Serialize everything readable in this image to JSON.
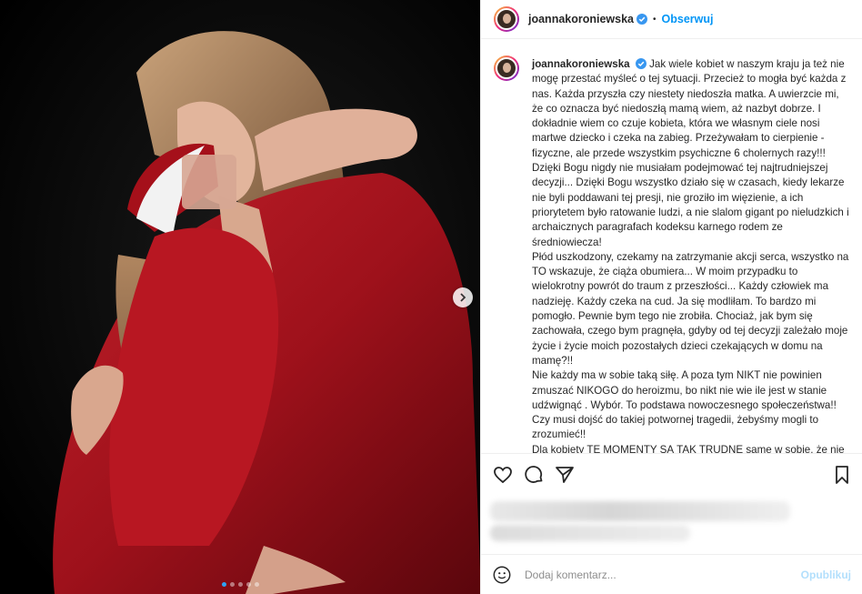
{
  "post": {
    "username": "joannakoroniewska",
    "separator": "•",
    "follow_label": "Obserwuj",
    "caption": [
      "Jak wiele kobiet w naszym kraju ja też nie mogę przestać myśleć o tej sytuacji. Przecież to mogła być każda z nas. Każda przyszła czy niestety niedoszła matka. A uwierzcie mi, że co oznacza być niedoszłą mamą wiem, aż nazbyt dobrze. I dokładnie wiem co czuje kobieta, która we własnym ciele nosi martwe dziecko i czeka na zabieg. Przeżywałam to cierpienie - fizyczne, ale przede wszystkim psychiczne 6 cholernych razy!!! Dzięki Bogu nigdy nie musiałam podejmować tej najtrudniejszej decyzji... Dzięki Bogu wszystko działo się w czasach, kiedy lekarze nie byli poddawani tej presji, nie groziło im więzienie, a ich priorytetem było ratowanie ludzi, a nie slalom gigant po nieludzkich i archaicznych paragrafach kodeksu karnego rodem ze średniowiecza!",
      "Płód uszkodzony, czekamy na zatrzymanie akcji serca, wszystko na TO wskazuje, że ciąża obumiera... W moim przypadku to wielokrotny powrót do traum z przeszłości... Każdy człowiek ma nadzieję. Każdy czeka na cud. Ja się modliłam. To bardzo mi pomogło. Pewnie bym tego nie zrobiła. Chociaż, jak bym się zachowała, czego bym pragnęła, gdyby od tej decyzji zależało moje życie i życie moich pozostałych dzieci czekających w domu na mamę?!!",
      "Nie każdy ma w sobie taką siłę. A poza tym NIKT nie powinien zmuszać NIKOGO do heroizmu, bo nikt nie wie ile jest w stanie udźwignąć . Wybór. To podstawa nowoczesnego społeczeństwa!! Czy musi dojść do takiej potwornej tragedii, żebyśmy mogli to zrozumieć!!",
      "Dla kobiety TE MOMENTY SĄ TAK TRUDNE same w sobie, że nie wyobrażam sobie, jak teraz ma udźwignąć kolejny ciężar choćby w postaci sprawdzania czy rzeczywiście WSZYSTKO jest zgodne z"
    ]
  },
  "carousel": {
    "total_slides": 5,
    "active_index": 0
  },
  "comment_box": {
    "placeholder": "Dodaj komentarz...",
    "post_label": "Opublikuj"
  },
  "colors": {
    "accent": "#0095f6",
    "post_disabled": "#b2dffc",
    "active_dot": "#2ea2f5",
    "dress": "#a3121c"
  },
  "icons": {
    "verified": "verified-badge-icon",
    "next": "chevron-right-icon",
    "like": "heart-icon",
    "comment": "comment-bubble-icon",
    "share": "paper-plane-icon",
    "save": "bookmark-icon",
    "emoji": "smiley-icon"
  }
}
